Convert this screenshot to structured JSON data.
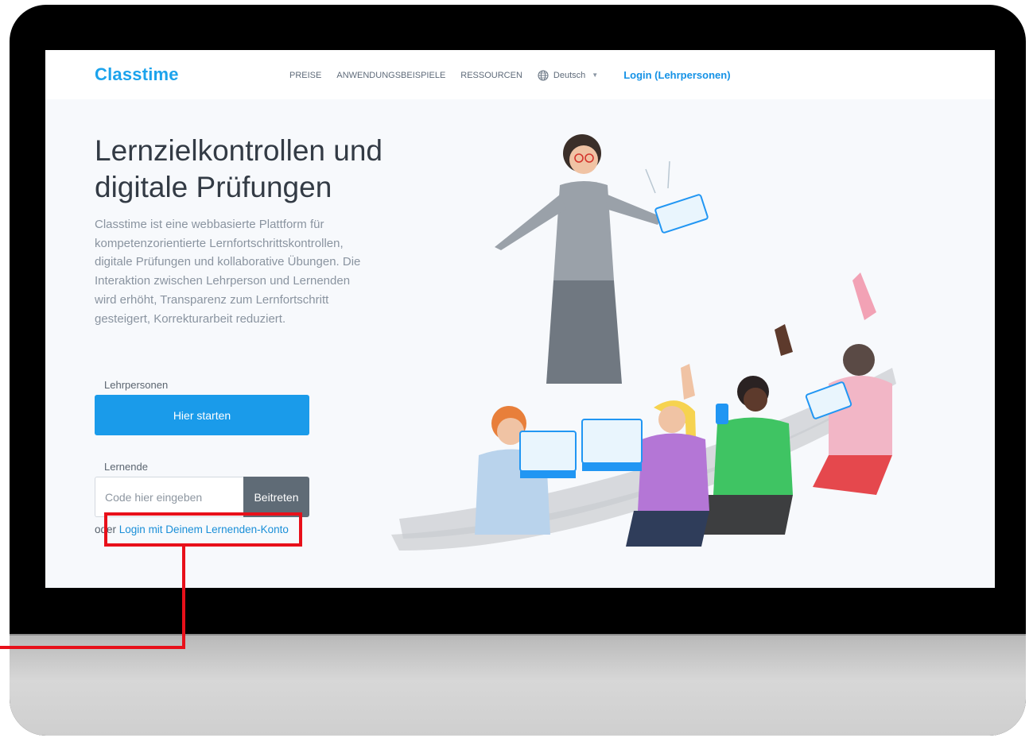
{
  "header": {
    "logo": "Classtime",
    "nav": [
      "PREISE",
      "ANWENDUNGSBEISPIELE",
      "RESSOURCEN"
    ],
    "language": "Deutsch",
    "login": "Login (Lehrpersonen)"
  },
  "hero": {
    "title_line1": "Lernzielkontrollen und",
    "title_line2": "digitale Prüfungen",
    "description": "Classtime ist eine webbasierte Plattform für kompetenzorientierte Lernfortschrittskontrollen, digitale Prüfungen und kollaborative Übungen. Die Interaktion zwischen Lehrperson und Lernenden wird erhöht, Transparenz zum Lernfortschritt gesteigert, Korrekturarbeit reduziert."
  },
  "teachers": {
    "label": "Lehrpersonen",
    "start_button": "Hier starten"
  },
  "students": {
    "label": "Lernende",
    "code_placeholder": "Code hier eingeben",
    "code_value": "",
    "join_button": "Beitreten",
    "or_text": "oder ",
    "login_link": "Login mit Deinem Lernenden-Konto"
  },
  "colors": {
    "brand_blue": "#1a9bea",
    "join_gray": "#5f6b76",
    "highlight_red": "#e8101a"
  },
  "icons": [
    "globe-icon",
    "chevron-down-icon"
  ]
}
